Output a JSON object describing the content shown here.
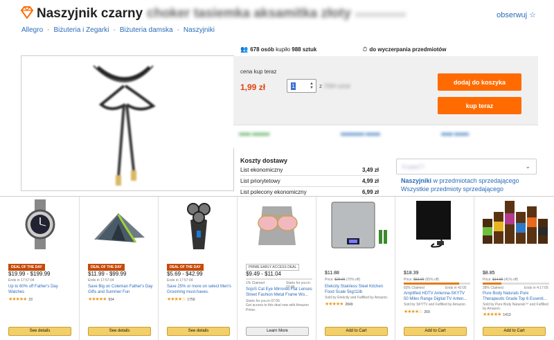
{
  "header": {
    "title": "Naszyjnik czarny",
    "title_blurred": "choker tasiemka aksamitka złoty",
    "id_blurred": "############",
    "observe_label": "obserwuj",
    "brand_color": "#ff6b00"
  },
  "breadcrumb": [
    "Allegro",
    "Biżuteria i Zegarki",
    "Biżuteria damska",
    "Naszyjniki"
  ],
  "stats": {
    "buyers": "678 osób",
    "bought_mid": "kupiło",
    "pieces": "988 sztuk",
    "until": "do wyczerpania przedmiotów"
  },
  "purchase": {
    "price_label": "cena kup teraz",
    "price": "1,99 zł",
    "quantity": "1",
    "quantity_of": "z",
    "quantity_of_blurred": "7084 sztuk",
    "add_to_cart": "dodaj do koszyka",
    "buy_now": "kup teraz"
  },
  "shipping": {
    "title": "Koszty dostawy",
    "rows": [
      {
        "name": "List ekonomiczny",
        "price": "3,49 zł"
      },
      {
        "name": "List priorytetowy",
        "price": "4,99 zł"
      },
      {
        "name": "List polecony ekonomiczny",
        "price": "6,99 zł"
      }
    ]
  },
  "seller": {
    "dropdown_blurred": "Frodot77",
    "link1_bold": "Naszyjniki",
    "link1_rest": "w przedmiotach sprzedającego",
    "link2": "Wszystkie przedmioty sprzedającego"
  },
  "deals": [
    {
      "badge": "DEAL OF THE DAY",
      "price": "$19.99 - $199.99",
      "ends": "Ends in 17:57:04",
      "title": "Up to 60% off Father's Day Watches",
      "reviews": "23",
      "button": "See details",
      "rating": 4.5
    },
    {
      "badge": "DEAL OF THE DAY",
      "price": "$11.99 - $99.99",
      "ends": "Ends in 17:57:04",
      "title": "Save Big on Coleman Father's Day Gifts and Summer Fun",
      "reviews": "934",
      "button": "See details",
      "rating": 4.5
    },
    {
      "badge": "DEAL OF THE DAY",
      "price": "$5.69 - $42.99",
      "ends": "Ends in 17:57:04",
      "title": "Save 25% or more on select Men's Grooming must-haves.",
      "reviews": "1759",
      "button": "See details",
      "rating": 4
    },
    {
      "badge": "PRIME EARLY ACCESS DEAL",
      "price": "$9.49 - $11.04",
      "claimed": "1% Claimed",
      "starts": "Starts for you in 07:05",
      "title": "SojoS Cat Eye Mirrored Flat Lenses Street Fashion Metal Frame Wo...",
      "note": "Starts for you in 07:05",
      "note2": "Get access to this deal now with Amazon Prime.",
      "button": "Learn More"
    },
    {
      "price": "$11.88",
      "list_price_label": "Price:",
      "list_price": "$29.99",
      "discount": "(70% off)",
      "title": "Etekcity Stainless Steel Kitchen Food Scale 5kg/11lb",
      "sold": "Sold by Etekcity and Fulfilled by Amazon.",
      "reviews": "2849",
      "button": "Add to Cart",
      "rating": 4.5
    },
    {
      "price": "$18.39",
      "list_price_label": "Price:",
      "list_price": "$53.99",
      "discount": "(65% off)",
      "claimed": "83% Claimed",
      "ends": "Ends in 42:05",
      "claimed_fraction": 0.83,
      "title": "Amplified HDTV Antenna-SKYTV 50 Miles Range Digital TV Anten...",
      "sold": "Sold by SKYTV and Fulfilled by Amazon.",
      "reviews": "269",
      "button": "Add to Cart",
      "rating": 4
    },
    {
      "price": "$8.85",
      "list_price_label": "Price:",
      "list_price": "$14.99",
      "discount": "(41% off)",
      "claimed": "28% Claimed",
      "ends": "Ends in 4:17:05",
      "claimed_fraction": 0.28,
      "title": "Pure Body Naturals Pure Therapeutic Grade Top 6 Essenti...",
      "sold": "Sold by Pure Body Naturals™ and Fulfilled by Amazon.",
      "reviews": "1413",
      "button": "Add to Cart",
      "rating": 4.5
    }
  ]
}
